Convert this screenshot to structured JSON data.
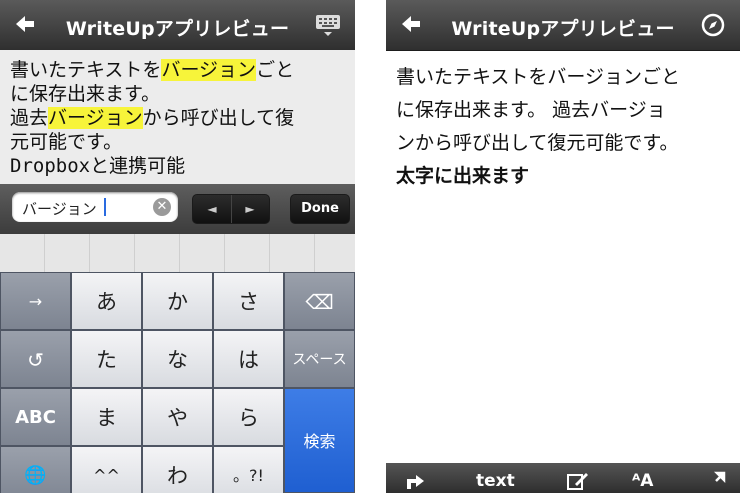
{
  "left_screen": {
    "navbar": {
      "title": "WriteUpアプリレビュー",
      "back_icon": "back-arrow-icon",
      "right_icon": "keyboard-icon"
    },
    "editor": {
      "lines": [
        {
          "pre": "書いたテキストを",
          "hl": "バージョン",
          "post": "ごと"
        },
        {
          "pre": "に保存出来ます。",
          "hl": "",
          "post": ""
        },
        {
          "pre": "過去",
          "hl": "バージョン",
          "post": "から呼び出して復"
        },
        {
          "pre": "元可能です。",
          "hl": "",
          "post": ""
        },
        {
          "pre": "Dropboxと連携可能",
          "hl": "",
          "post": ""
        }
      ],
      "highlight_color": "#f7f43a"
    },
    "search": {
      "value": "バージョン",
      "prev_label": "◄",
      "next_label": "►",
      "done_label": "Done"
    },
    "keyboard": {
      "rows": [
        [
          "→",
          "あ",
          "か",
          "さ",
          "⌫"
        ],
        [
          "↺",
          "た",
          "な",
          "は",
          "スペース"
        ],
        [
          "ABC",
          "ま",
          "や",
          "ら",
          "検索"
        ],
        [
          "🌐",
          "^^",
          "わ",
          "。?!"
        ]
      ]
    }
  },
  "right_screen": {
    "navbar": {
      "title": "WriteUpアプリレビュー",
      "back_icon": "back-arrow-icon",
      "right_icon": "compass-icon"
    },
    "preview": {
      "lines": [
        "書いたテキストをバージョンごと",
        "に保存出来ます。 過去バージョ",
        "ンから呼び出して復元可能です。"
      ],
      "bold_line": "太字に出来ます"
    },
    "toolbar": {
      "share_icon": "share-icon",
      "mode_label": "text",
      "edit_icon": "edit-icon",
      "font_label": "ᴬA",
      "expand_icon": "expand-icon"
    }
  }
}
